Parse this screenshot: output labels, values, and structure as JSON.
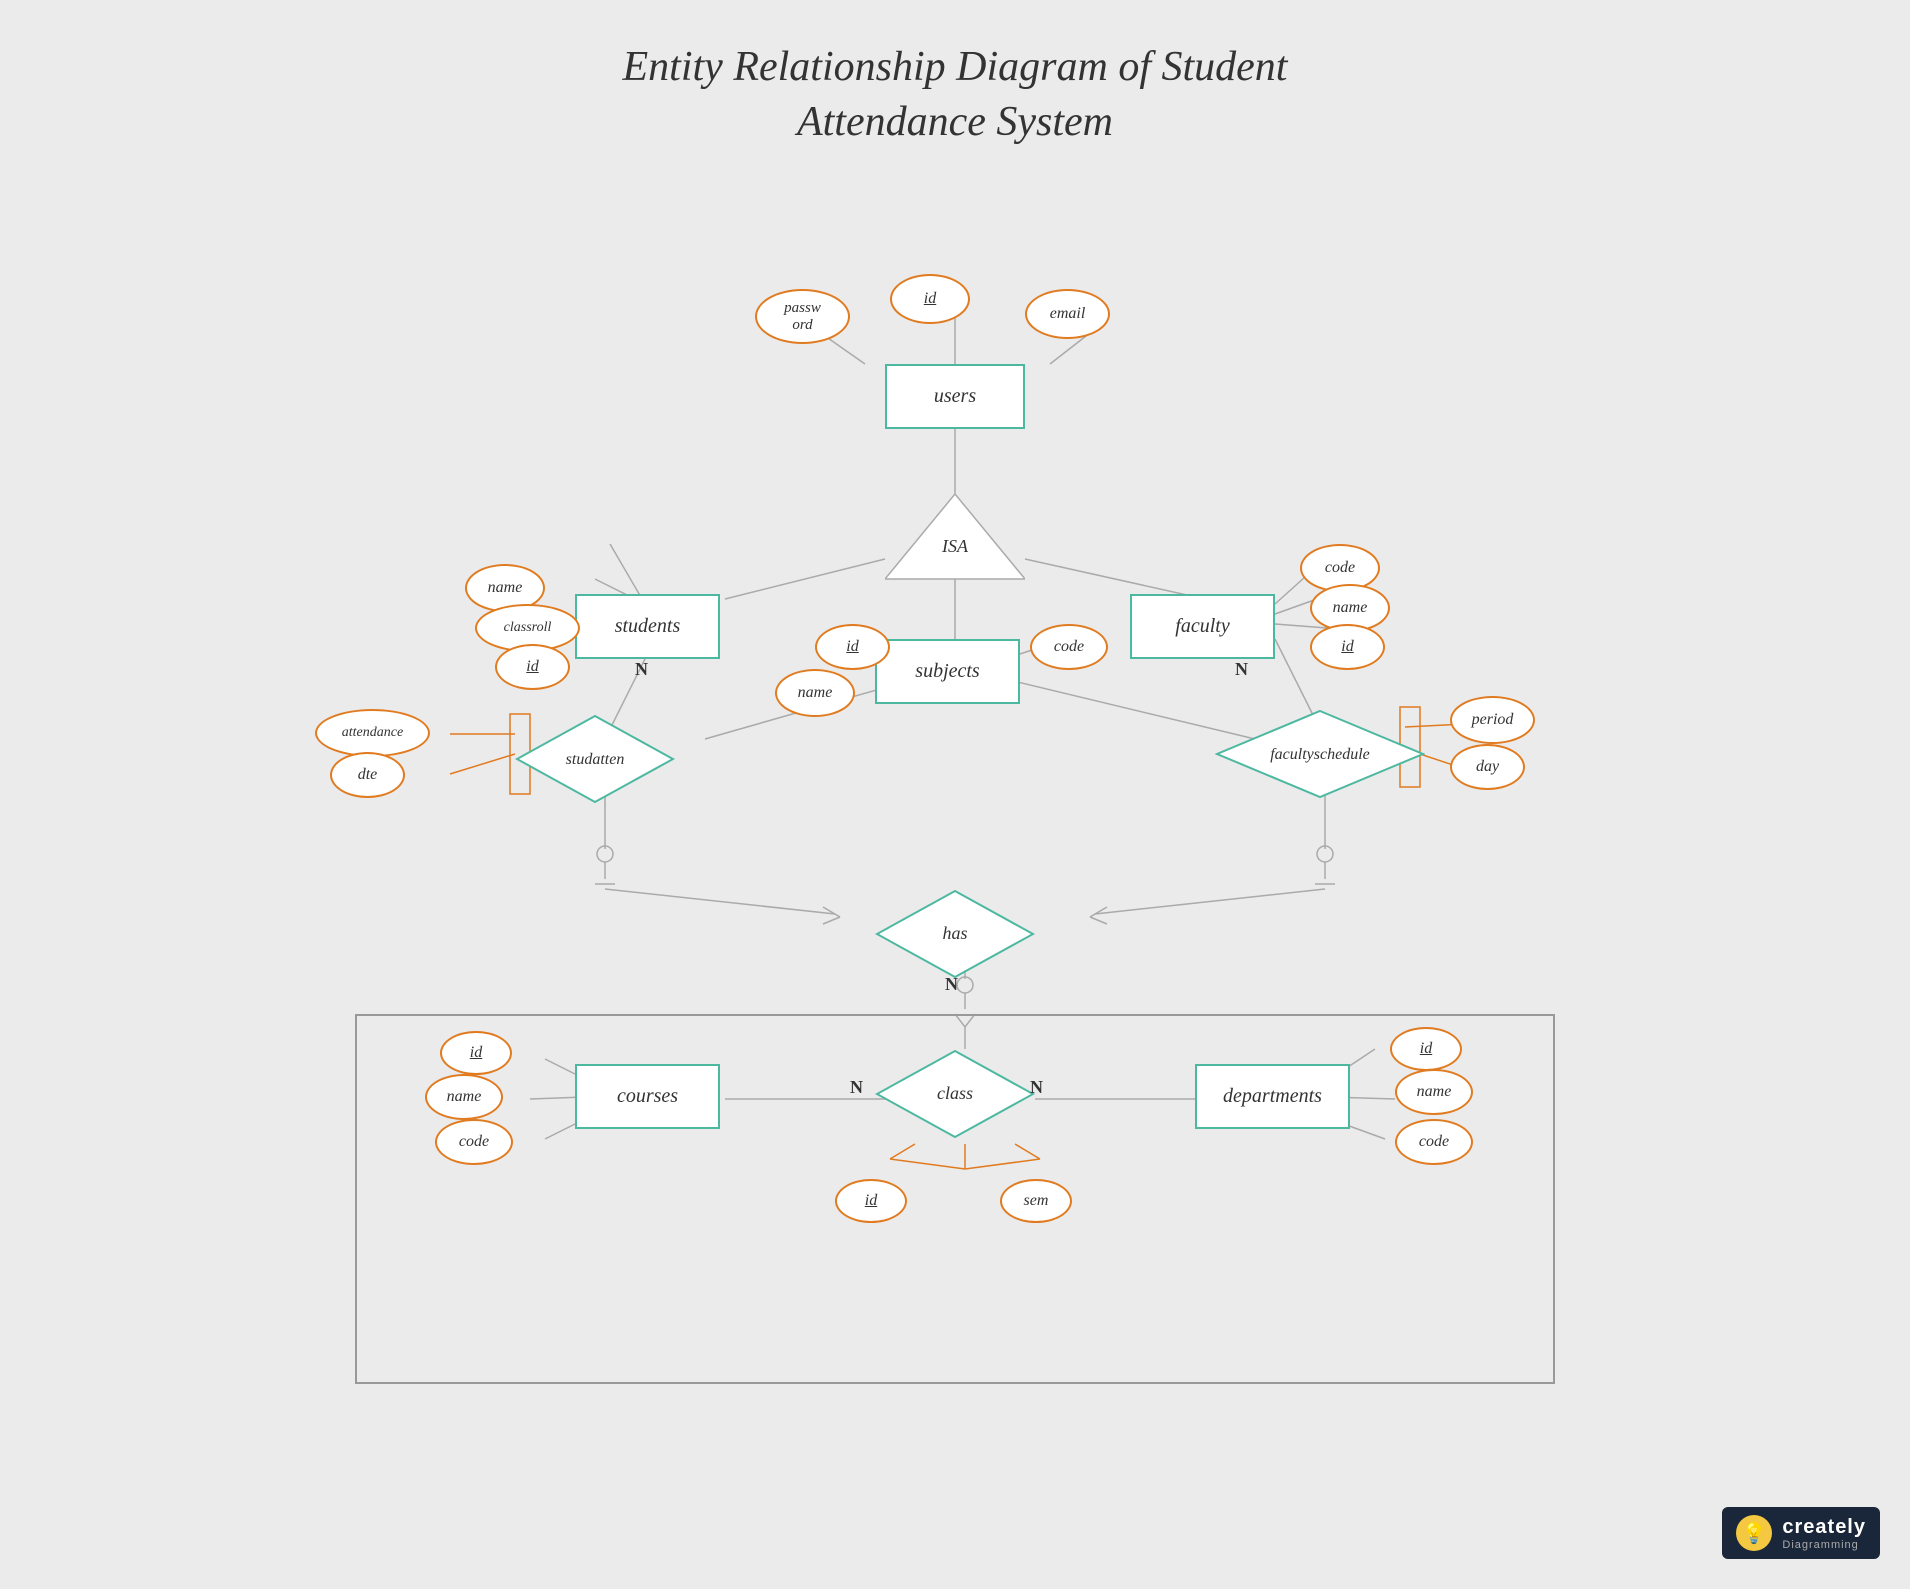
{
  "title": {
    "line1": "Entity Relationship Diagram of Student",
    "line2": "Attendance System"
  },
  "entities": {
    "users": "users",
    "students": "students",
    "faculty": "faculty",
    "subjects": "subjects",
    "courses": "courses",
    "class": "class",
    "departments": "departments"
  },
  "relationships": {
    "isa": "ISA",
    "studatten": "studatten",
    "facultyschedule": "facultyschedule",
    "has": "has"
  },
  "attributes": {
    "users_id": "id",
    "users_password": "password",
    "users_email": "email",
    "students_name": "name",
    "students_classroll": "classroll",
    "students_id": "id",
    "faculty_code": "code",
    "faculty_name": "name",
    "faculty_id": "id",
    "subjects_id": "id",
    "subjects_name": "name",
    "subjects_code": "code",
    "studatten_attendance": "attendance",
    "studatten_dte": "dte",
    "facultyschedule_period": "period",
    "facultyschedule_day": "day",
    "courses_id": "id",
    "courses_name": "name",
    "courses_code": "code",
    "class_id": "id",
    "class_sem": "sem",
    "departments_id": "id",
    "departments_name": "name",
    "departments_code": "code"
  },
  "mult": {
    "n1": "N",
    "n2": "N",
    "n3": "N",
    "n4": "N"
  },
  "logo": {
    "name": "creately",
    "sub": "Diagramming",
    "bulb": "💡"
  }
}
